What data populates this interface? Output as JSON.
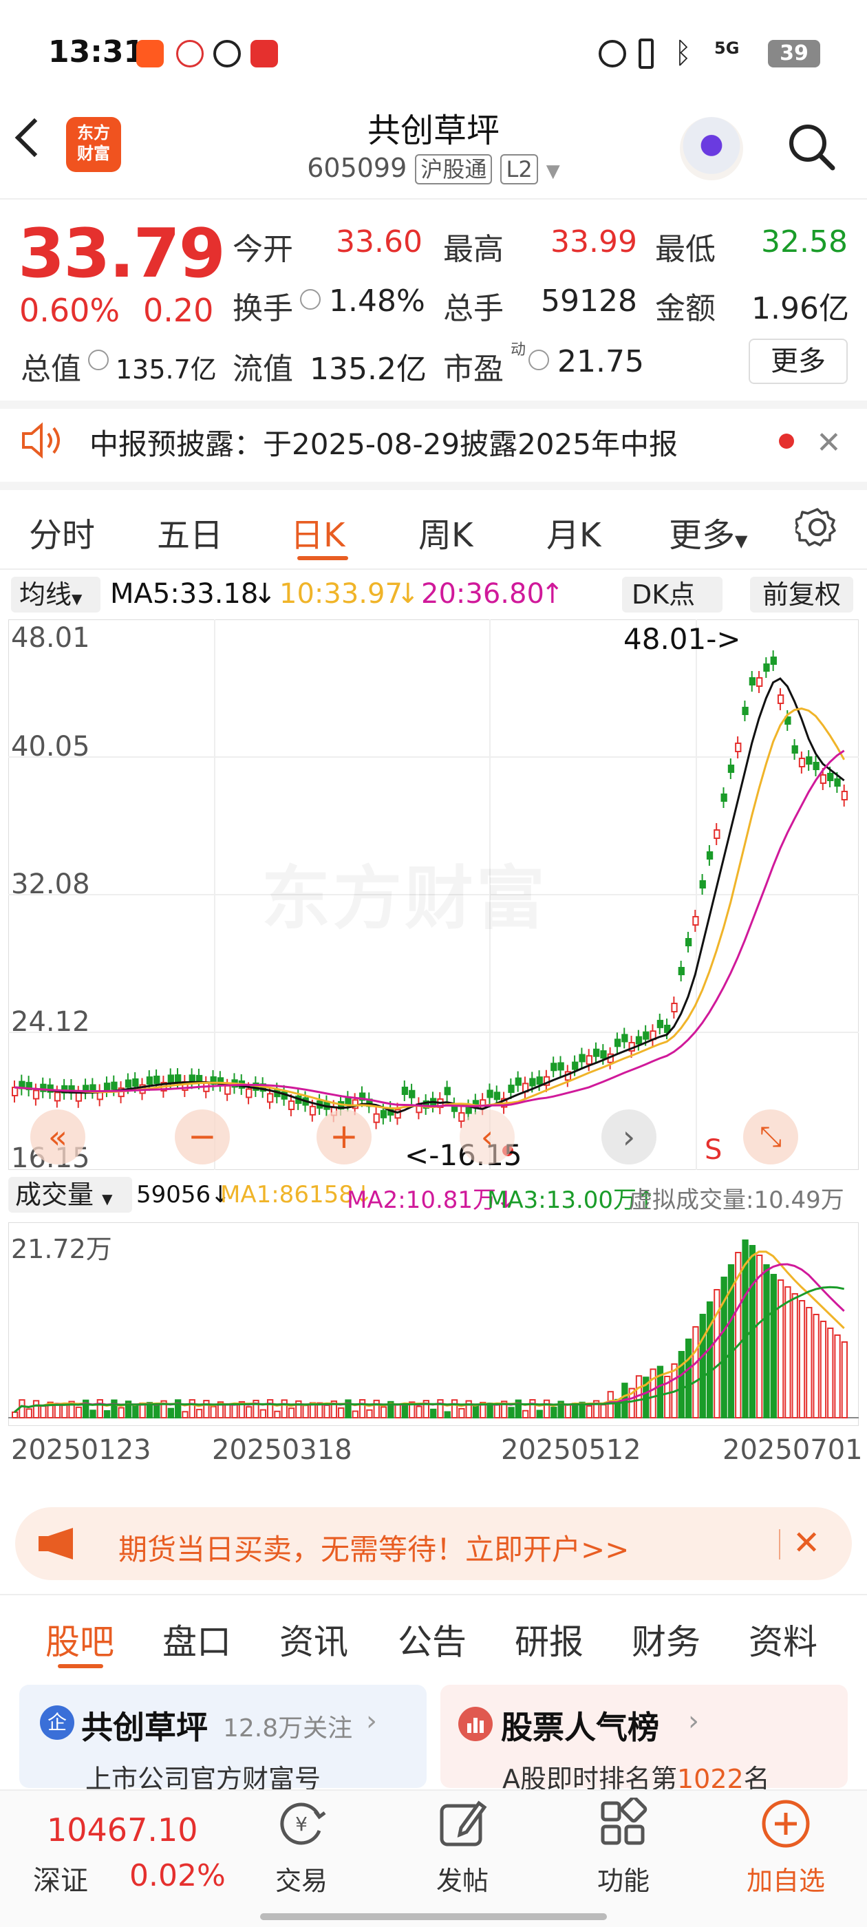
{
  "status_bar": {
    "time": "13:31",
    "battery": "39",
    "network": "5G"
  },
  "header": {
    "title": "共创草坪",
    "code": "605099",
    "market_tag": "沪股通",
    "level_tag": "L2",
    "logo_text": "东方\n财富"
  },
  "quote": {
    "price": "33.79",
    "change_pct": "0.60%",
    "change_amt": "0.20",
    "open_label": "今开",
    "open": "33.60",
    "high_label": "最高",
    "high": "33.99",
    "low_label": "最低",
    "low": "32.58",
    "turnover_label": "换手",
    "turnover": "1.48%",
    "volume_label": "总手",
    "volume": "59128",
    "amount_label": "金额",
    "amount": "1.96亿",
    "mcap_label": "总值",
    "mcap": "135.7亿",
    "float_label": "流值",
    "float": "135.2亿",
    "pe_label": "市盈",
    "pe_sup": "动",
    "pe": "21.75",
    "more_button": "更多"
  },
  "notice": {
    "text": "中报预披露：于2025-08-29披露2025年中报"
  },
  "chart_tabs": [
    "分时",
    "五日",
    "日K",
    "周K",
    "月K",
    "更多"
  ],
  "active_tab": "日K",
  "ma_bar": {
    "selector": "均线",
    "ma5": "MA5:33.18",
    "ma10": "10:33.97",
    "ma20": "20:36.80",
    "dk_button": "DK点",
    "adjust_button": "前复权"
  },
  "kline": {
    "y_labels": [
      "48.01",
      "40.05",
      "32.08",
      "24.12",
      "16.15"
    ],
    "max_annotation": "48.01->",
    "min_annotation": "<-16.15",
    "s_marker": "S",
    "watermark": "东方财富"
  },
  "volume_bar": {
    "selector": "成交量",
    "vol": "59056",
    "ma1": "MA1:86158",
    "ma2": "MA2:10.81万",
    "ma3": "MA3:13.00万",
    "virtual": "虚拟成交量:10.49万",
    "y_max": "21.72万"
  },
  "dates": [
    "20250123",
    "20250318",
    "20250512",
    "20250701"
  ],
  "colors": {
    "up": "#e5302e",
    "down": "#1a9c29",
    "ma5": "#111111",
    "ma10": "#f0b429",
    "ma20": "#d0199a",
    "accent": "#e85d22"
  },
  "ad_banner": {
    "text": "期货当日买卖，无需等待！立即开户>>"
  },
  "sub_tabs": [
    "股吧",
    "盘口",
    "资讯",
    "公告",
    "研报",
    "财务",
    "资料"
  ],
  "active_sub_tab": "股吧",
  "cards": [
    {
      "icon": "企",
      "title": "共创草坪",
      "followers": "12.8万关注",
      "subtitle": "上市公司官方财富号"
    },
    {
      "title": "股票人气榜",
      "subtitle_prefix": "A股即时排名第",
      "rank": "1022",
      "subtitle_suffix": "名"
    }
  ],
  "bottom_nav": {
    "index_value": "10467.10",
    "index_name": "深证",
    "index_change": "0.02%",
    "items": [
      "交易",
      "发帖",
      "功能",
      "加自选"
    ]
  }
}
